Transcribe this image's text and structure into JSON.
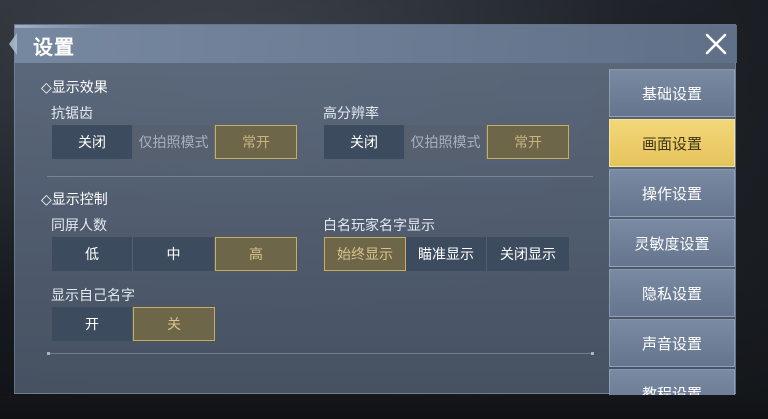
{
  "dialog": {
    "title": "设置"
  },
  "sections": {
    "display_effect": {
      "title": "◇显示效果",
      "antialias": {
        "label": "抗锯齿",
        "options": [
          "关闭",
          "仅拍照模式",
          "常开"
        ],
        "selected": "常开"
      },
      "hires": {
        "label": "高分辨率",
        "options": [
          "关闭",
          "仅拍照模式",
          "常开"
        ],
        "selected": "常开"
      }
    },
    "display_control": {
      "title": "◇显示控制",
      "players_on_screen": {
        "label": "同屏人数",
        "options": [
          "低",
          "中",
          "高"
        ],
        "selected": "高"
      },
      "whitelist_names": {
        "label": "白名玩家名字显示",
        "options": [
          "始终显示",
          "瞄准显示",
          "关闭显示"
        ],
        "selected": "始终显示"
      },
      "own_name": {
        "label": "显示自己名字",
        "options": [
          "开",
          "关"
        ],
        "selected": "关"
      }
    }
  },
  "sidebar": {
    "tabs": [
      {
        "label": "基础设置",
        "active": false
      },
      {
        "label": "画面设置",
        "active": true
      },
      {
        "label": "操作设置",
        "active": false
      },
      {
        "label": "灵敏度设置",
        "active": false
      },
      {
        "label": "隐私设置",
        "active": false
      },
      {
        "label": "声音设置",
        "active": false
      },
      {
        "label": "教程设置",
        "active": false
      }
    ]
  },
  "colors": {
    "accent_active_tab": "#e6c45d",
    "selected_option_border": "#c7ad5c",
    "panel": "#607088"
  },
  "icons": {
    "close": "close-icon",
    "section_marker": "diamond-icon"
  }
}
